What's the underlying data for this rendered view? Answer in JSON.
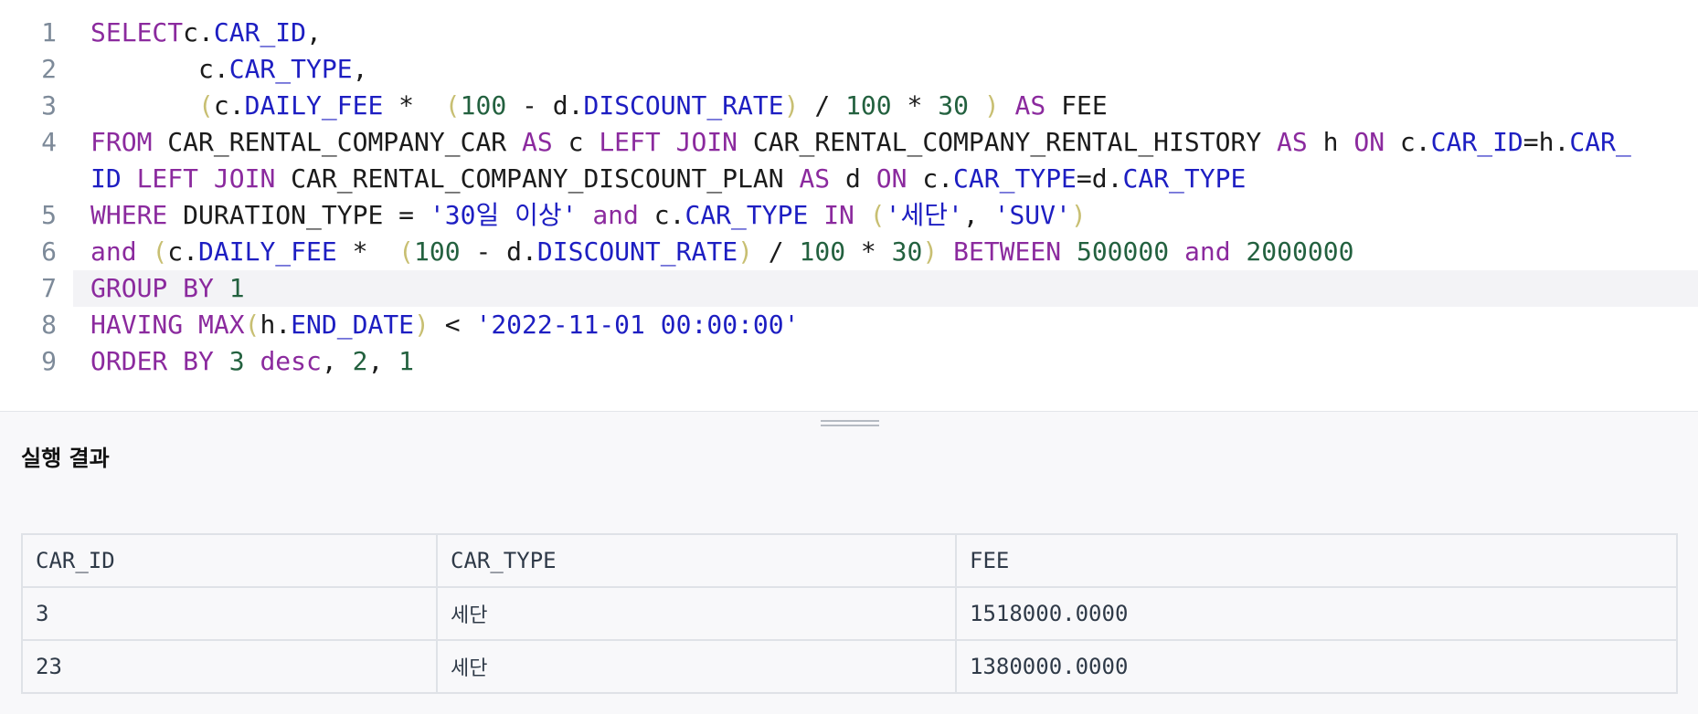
{
  "editor": {
    "line_numbers": [
      "1",
      "2",
      "3",
      "4",
      "",
      "5",
      "6",
      "7",
      "8",
      "9"
    ],
    "lines": [
      {
        "parts": [
          [
            "kw",
            "SELECT"
          ],
          [
            "",
            "c"
          ],
          [
            "",
            "."
          ],
          [
            "fld",
            "CAR_ID"
          ],
          [
            "",
            ","
          ]
        ]
      },
      {
        "parts": [
          [
            "",
            "       c"
          ],
          [
            "",
            "."
          ],
          [
            "fld",
            "CAR_TYPE"
          ],
          [
            "",
            ","
          ]
        ]
      },
      {
        "parts": [
          [
            "",
            "       "
          ],
          [
            "par",
            "("
          ],
          [
            "",
            "c"
          ],
          [
            "",
            "."
          ],
          [
            "fld",
            "DAILY_FEE"
          ],
          [
            "",
            " *  "
          ],
          [
            "par",
            "("
          ],
          [
            "num",
            "100"
          ],
          [
            "",
            " - d"
          ],
          [
            "",
            "."
          ],
          [
            "fld",
            "DISCOUNT_RATE"
          ],
          [
            "par",
            ")"
          ],
          [
            "",
            " / "
          ],
          [
            "num",
            "100"
          ],
          [
            "",
            " * "
          ],
          [
            "num",
            "30"
          ],
          [
            "",
            " "
          ],
          [
            "par",
            ")"
          ],
          [
            "",
            " "
          ],
          [
            "kw",
            "AS"
          ],
          [
            "",
            " FEE"
          ]
        ]
      },
      {
        "parts": [
          [
            "kw",
            "FROM"
          ],
          [
            "",
            " CAR_RENTAL_COMPANY_CAR "
          ],
          [
            "kw",
            "AS"
          ],
          [
            "",
            " c "
          ],
          [
            "kw",
            "LEFT JOIN"
          ],
          [
            "",
            " CAR_RENTAL_COMPANY_RENTAL_HISTORY "
          ],
          [
            "kw",
            "AS"
          ],
          [
            "",
            " h "
          ],
          [
            "kw",
            "ON"
          ],
          [
            "",
            " c"
          ],
          [
            "",
            "."
          ],
          [
            "fld",
            "CAR_ID"
          ],
          [
            "",
            "=h"
          ],
          [
            "",
            "."
          ],
          [
            "fld",
            "CAR_"
          ]
        ]
      },
      {
        "parts": [
          [
            "fld",
            "ID"
          ],
          [
            "",
            " "
          ],
          [
            "kw",
            "LEFT JOIN"
          ],
          [
            "",
            " CAR_RENTAL_COMPANY_DISCOUNT_PLAN "
          ],
          [
            "kw",
            "AS"
          ],
          [
            "",
            " d "
          ],
          [
            "kw",
            "ON"
          ],
          [
            "",
            " c"
          ],
          [
            "",
            "."
          ],
          [
            "fld",
            "CAR_TYPE"
          ],
          [
            "",
            "=d"
          ],
          [
            "",
            "."
          ],
          [
            "fld",
            "CAR_TYPE"
          ]
        ]
      },
      {
        "parts": [
          [
            "kw",
            "WHERE"
          ],
          [
            "",
            " DURATION_TYPE = "
          ],
          [
            "str",
            "'30일 이상'"
          ],
          [
            "",
            " "
          ],
          [
            "kw",
            "and"
          ],
          [
            "",
            " c"
          ],
          [
            "",
            "."
          ],
          [
            "fld",
            "CAR_TYPE"
          ],
          [
            "",
            " "
          ],
          [
            "kw",
            "IN"
          ],
          [
            "",
            " "
          ],
          [
            "par",
            "("
          ],
          [
            "str",
            "'세단'"
          ],
          [
            "",
            ", "
          ],
          [
            "str",
            "'SUV'"
          ],
          [
            "par",
            ")"
          ]
        ]
      },
      {
        "parts": [
          [
            "kw",
            "and"
          ],
          [
            "",
            " "
          ],
          [
            "par",
            "("
          ],
          [
            "",
            "c"
          ],
          [
            "",
            "."
          ],
          [
            "fld",
            "DAILY_FEE"
          ],
          [
            "",
            " *  "
          ],
          [
            "par",
            "("
          ],
          [
            "num",
            "100"
          ],
          [
            "",
            " - d"
          ],
          [
            "",
            "."
          ],
          [
            "fld",
            "DISCOUNT_RATE"
          ],
          [
            "par",
            ")"
          ],
          [
            "",
            " / "
          ],
          [
            "num",
            "100"
          ],
          [
            "",
            " * "
          ],
          [
            "num",
            "30"
          ],
          [
            "par",
            ")"
          ],
          [
            "",
            " "
          ],
          [
            "kw",
            "BETWEEN"
          ],
          [
            "",
            " "
          ],
          [
            "num",
            "500000"
          ],
          [
            "",
            " "
          ],
          [
            "kw",
            "and"
          ],
          [
            "",
            " "
          ],
          [
            "num",
            "2000000"
          ]
        ]
      },
      {
        "parts": [
          [
            "kw",
            "GROUP BY"
          ],
          [
            "",
            " "
          ],
          [
            "num",
            "1"
          ]
        ]
      },
      {
        "parts": [
          [
            "kw",
            "HAVING"
          ],
          [
            "",
            " "
          ],
          [
            "kw",
            "MAX"
          ],
          [
            "par",
            "("
          ],
          [
            "",
            "h"
          ],
          [
            "",
            "."
          ],
          [
            "fld",
            "END_DATE"
          ],
          [
            "par",
            ")"
          ],
          [
            "",
            " < "
          ],
          [
            "str",
            "'2022-11-01 00:00:00'"
          ]
        ]
      },
      {
        "parts": [
          [
            "kw",
            "ORDER BY"
          ],
          [
            "",
            " "
          ],
          [
            "num",
            "3"
          ],
          [
            "",
            " "
          ],
          [
            "kw",
            "desc"
          ],
          [
            "",
            ", "
          ],
          [
            "num",
            "2"
          ],
          [
            "",
            ", "
          ],
          [
            "num",
            "1"
          ]
        ]
      }
    ]
  },
  "results_panel": {
    "title": "실행 결과",
    "columns": [
      "CAR_ID",
      "CAR_TYPE",
      "FEE"
    ],
    "rows": [
      [
        "3",
        "세단",
        "1518000.0000"
      ],
      [
        "23",
        "세단",
        "1380000.0000"
      ]
    ]
  }
}
